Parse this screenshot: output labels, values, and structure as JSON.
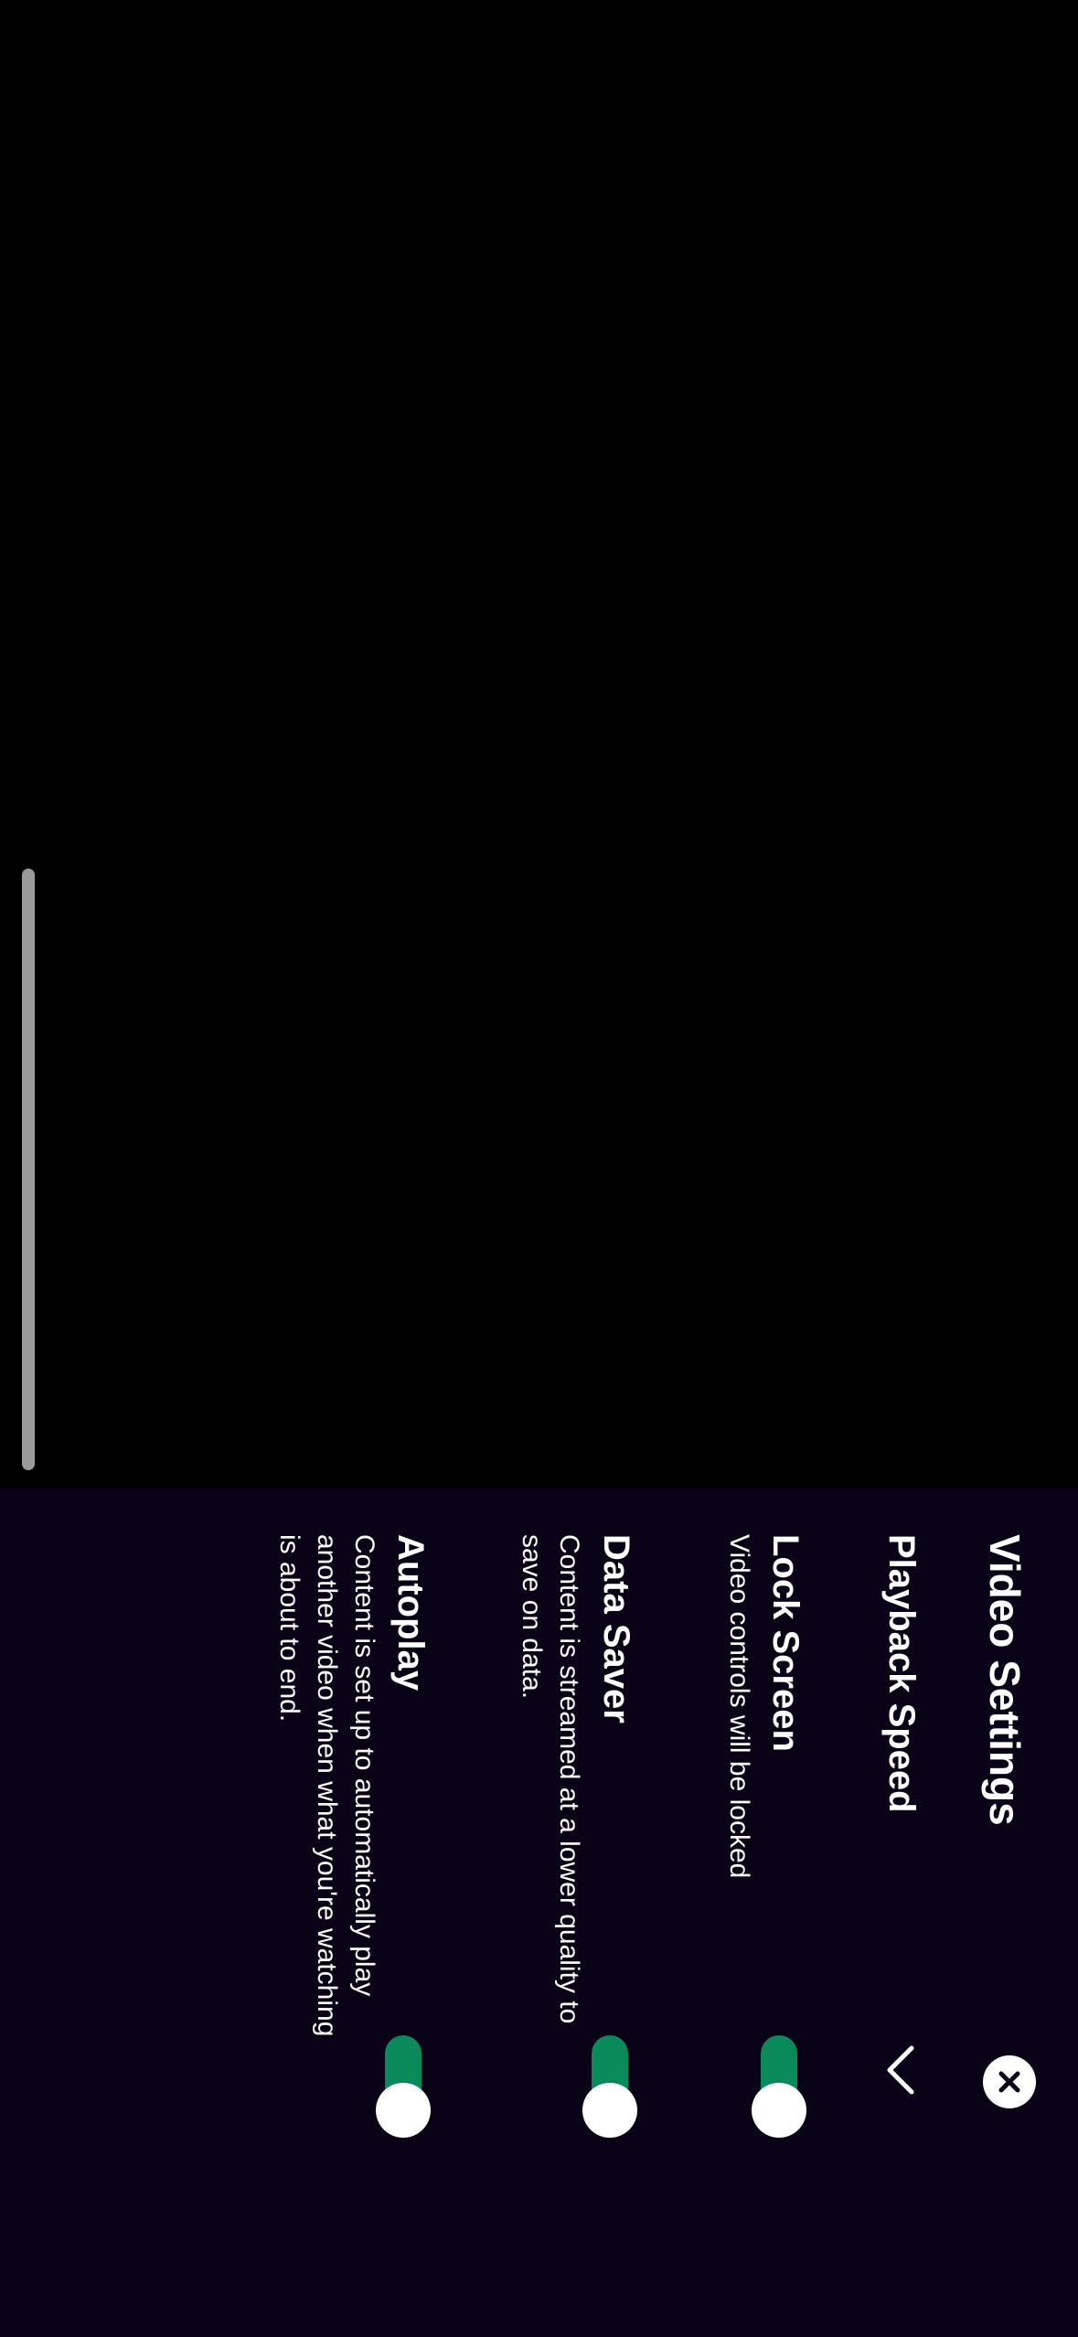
{
  "sheet": {
    "title": "Video Settings"
  },
  "settings": {
    "playback_speed": {
      "label": "Playback Speed"
    },
    "lock_screen": {
      "label": "Lock Screen",
      "description": "Video controls will be locked",
      "enabled": true
    },
    "data_saver": {
      "label": "Data Saver",
      "description": "Content is streamed at a lower quality to save on data.",
      "enabled": true
    },
    "autoplay": {
      "label": "Autoplay",
      "description": "Content is set up to automatically play another video when what you're watching is about to end.",
      "enabled": true
    }
  },
  "colors": {
    "sheet_background": "#0a0317",
    "toggle_on": "#0a8a5a",
    "scrubber": "#9a9a9a"
  },
  "icons": {
    "close": "close-icon",
    "expand": "chevron-down-icon"
  }
}
